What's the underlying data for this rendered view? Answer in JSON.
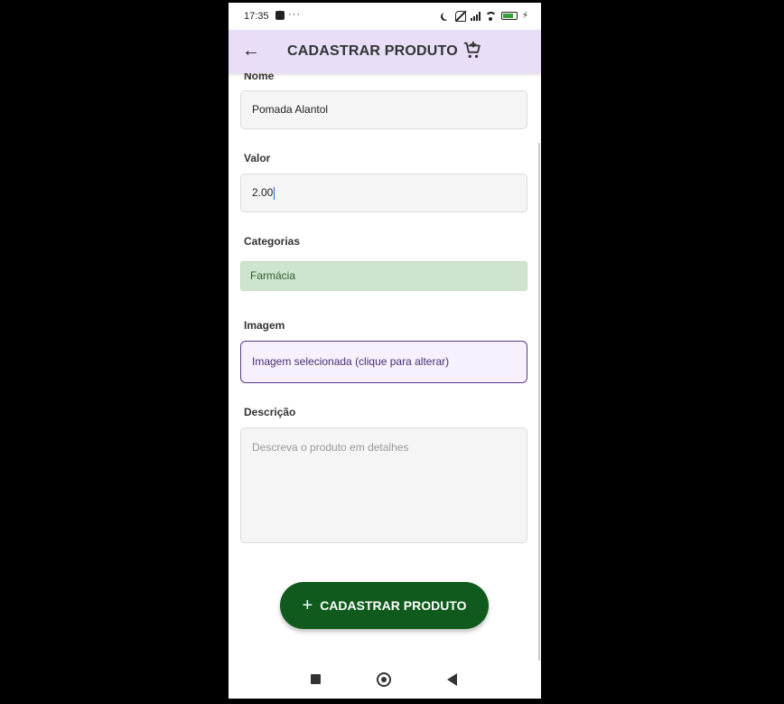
{
  "status_bar": {
    "time": "17:35",
    "dots": "···",
    "battery_percent": 85
  },
  "app_bar": {
    "title": "CADASTRAR PRODUTO",
    "back_icon": "arrow-left-icon",
    "cart_icon": "cart-plus-icon"
  },
  "form": {
    "nome": {
      "label": "Nome",
      "value": "Pomada Alantol"
    },
    "valor": {
      "label": "Valor",
      "value": "2.00"
    },
    "categorias": {
      "label": "Categorias",
      "selected": "Farmácia"
    },
    "imagem": {
      "label": "Imagem",
      "button_text": "Imagem selecionada (clique para alterar)"
    },
    "descricao": {
      "label": "Descrição",
      "placeholder": "Descreva o produto em detalhes"
    }
  },
  "submit_button": {
    "label": "CADASTRAR PRODUTO",
    "icon": "plus-icon"
  },
  "colors": {
    "app_bar": "#e8def8",
    "button": "#0f5a1c",
    "chip": "#cfe4cf",
    "image_border": "#5b3a8a"
  }
}
